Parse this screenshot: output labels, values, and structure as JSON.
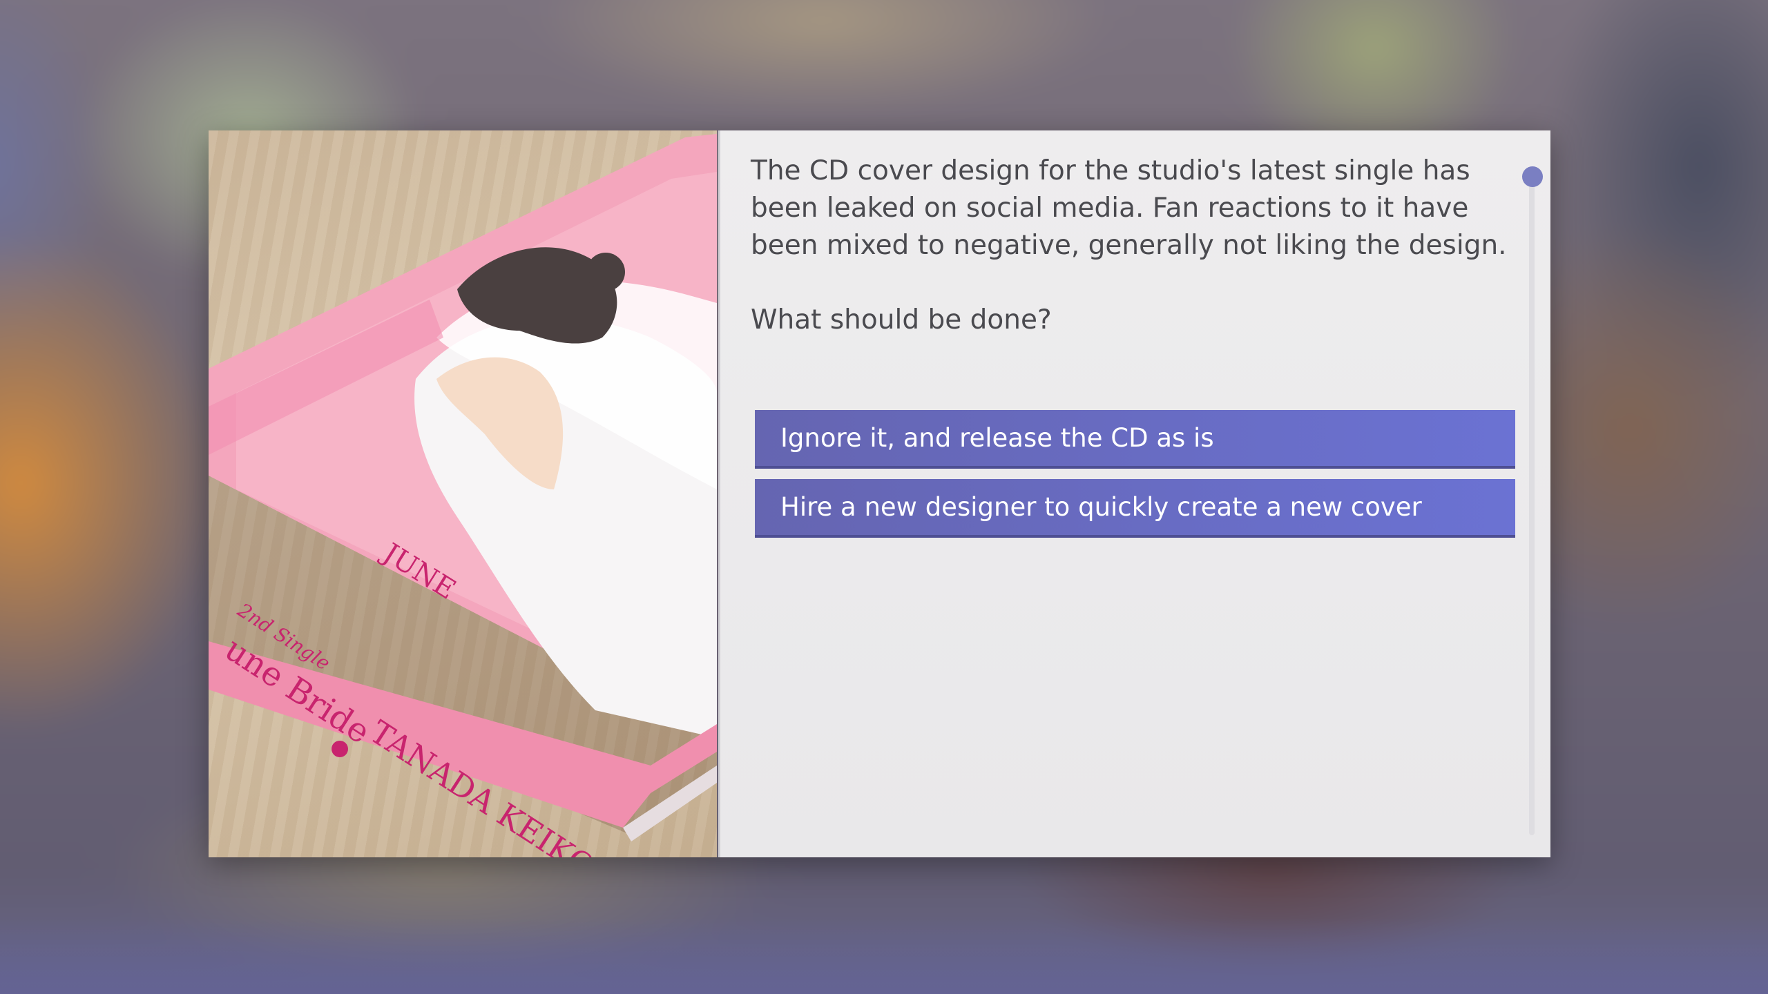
{
  "event": {
    "story_lines": [
      "The CD cover design for the studio's latest single has",
      "been leaked on social media. Fan reactions to it have",
      "been mixed to negative, generally not liking the design."
    ],
    "question": "What should be done?",
    "choices": [
      {
        "label": "Ignore it, and release the CD as is"
      },
      {
        "label": "Hire a new designer to quickly create a new cover"
      }
    ]
  },
  "artwork": {
    "spine_title": "une Bride",
    "spine_artist": "TANADA KEIKO",
    "spine_subtitle": "2nd Single",
    "cover_title": "JUNE"
  },
  "colors": {
    "choice_button": "#6b70cc",
    "panel_background": "#ecebed",
    "text": "#4a4a4f",
    "scroll_thumb": "#7a7fc2",
    "cd_pink": "#f0a0b8",
    "cd_text": "#c8246e"
  }
}
